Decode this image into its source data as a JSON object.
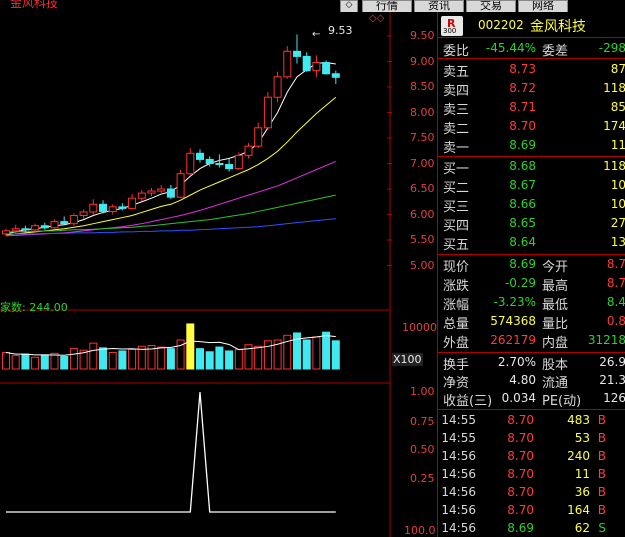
{
  "window": {
    "title": "金风科技",
    "menus": [
      "行情",
      "资讯",
      "交易",
      "网络"
    ]
  },
  "stock": {
    "code": "002202",
    "name": "金风科技",
    "badge": "R",
    "badge_sub": "300"
  },
  "chart": {
    "max_price_label": "9.53",
    "price_ticks": [
      "9.50",
      "9.00",
      "8.50",
      "8.00",
      "7.50",
      "7.00",
      "6.50",
      "6.00",
      "5.50",
      "5.00"
    ],
    "volume_ticks": [
      "10000",
      "X100"
    ],
    "volume_label": "家数: 244.00",
    "indicator_ticks": [
      "1.00",
      "0.75",
      "0.50",
      "0.25",
      "100.0"
    ],
    "colors": {
      "up": "#ff3030",
      "down": "#40e8f0",
      "ma5": "#ffffff",
      "ma10": "#ffff40",
      "ma20": "#e030e0",
      "ma30": "#30c030",
      "ma60": "#3030ff"
    },
    "candles": [
      {
        "o": 5.62,
        "h": 5.72,
        "l": 5.58,
        "c": 5.68
      },
      {
        "o": 5.68,
        "h": 5.8,
        "l": 5.62,
        "c": 5.72
      },
      {
        "o": 5.72,
        "h": 5.78,
        "l": 5.64,
        "c": 5.7
      },
      {
        "o": 5.7,
        "h": 5.82,
        "l": 5.66,
        "c": 5.78
      },
      {
        "o": 5.78,
        "h": 5.84,
        "l": 5.7,
        "c": 5.74
      },
      {
        "o": 5.74,
        "h": 5.9,
        "l": 5.72,
        "c": 5.86
      },
      {
        "o": 5.86,
        "h": 5.96,
        "l": 5.8,
        "c": 5.82
      },
      {
        "o": 5.82,
        "h": 6.02,
        "l": 5.78,
        "c": 5.98
      },
      {
        "o": 5.98,
        "h": 6.1,
        "l": 5.92,
        "c": 6.05
      },
      {
        "o": 6.05,
        "h": 6.3,
        "l": 6.0,
        "c": 6.2
      },
      {
        "o": 6.2,
        "h": 6.28,
        "l": 6.02,
        "c": 6.06
      },
      {
        "o": 6.06,
        "h": 6.2,
        "l": 6.0,
        "c": 6.15
      },
      {
        "o": 6.15,
        "h": 6.22,
        "l": 6.08,
        "c": 6.12
      },
      {
        "o": 6.12,
        "h": 6.4,
        "l": 6.1,
        "c": 6.32
      },
      {
        "o": 6.32,
        "h": 6.48,
        "l": 6.26,
        "c": 6.42
      },
      {
        "o": 6.42,
        "h": 6.52,
        "l": 6.36,
        "c": 6.46
      },
      {
        "o": 6.46,
        "h": 6.58,
        "l": 6.4,
        "c": 6.5
      },
      {
        "o": 6.5,
        "h": 6.58,
        "l": 6.3,
        "c": 6.34
      },
      {
        "o": 6.34,
        "h": 6.88,
        "l": 6.32,
        "c": 6.8
      },
      {
        "o": 6.8,
        "h": 7.3,
        "l": 6.76,
        "c": 7.2
      },
      {
        "o": 7.2,
        "h": 7.28,
        "l": 7.02,
        "c": 7.08
      },
      {
        "o": 7.08,
        "h": 7.14,
        "l": 6.94,
        "c": 7.0
      },
      {
        "o": 7.0,
        "h": 7.18,
        "l": 6.92,
        "c": 6.98
      },
      {
        "o": 6.98,
        "h": 7.1,
        "l": 6.84,
        "c": 6.9
      },
      {
        "o": 6.9,
        "h": 7.22,
        "l": 6.88,
        "c": 7.16
      },
      {
        "o": 7.16,
        "h": 7.4,
        "l": 7.1,
        "c": 7.34
      },
      {
        "o": 7.34,
        "h": 7.8,
        "l": 7.3,
        "c": 7.7
      },
      {
        "o": 7.7,
        "h": 8.4,
        "l": 7.66,
        "c": 8.3
      },
      {
        "o": 8.3,
        "h": 8.8,
        "l": 8.2,
        "c": 8.7
      },
      {
        "o": 8.7,
        "h": 9.3,
        "l": 8.66,
        "c": 9.2
      },
      {
        "o": 9.2,
        "h": 9.53,
        "l": 8.96,
        "c": 9.1
      },
      {
        "o": 9.1,
        "h": 9.18,
        "l": 8.8,
        "c": 8.82
      },
      {
        "o": 8.82,
        "h": 9.12,
        "l": 8.7,
        "c": 8.98
      },
      {
        "o": 8.98,
        "h": 9.02,
        "l": 8.74,
        "c": 8.76
      },
      {
        "o": 8.76,
        "h": 8.82,
        "l": 8.56,
        "c": 8.69
      }
    ],
    "ma_lines": [
      {
        "name": "ma5",
        "color": "#ffffff",
        "pts": [
          5.62,
          5.66,
          5.7,
          5.72,
          5.75,
          5.78,
          5.8,
          5.84,
          5.9,
          5.98,
          6.04,
          6.08,
          6.12,
          6.18,
          6.25,
          6.32,
          6.4,
          6.45,
          6.58,
          6.75,
          6.9,
          7.0,
          7.06,
          7.1,
          7.16,
          7.24,
          7.4,
          7.7,
          8.0,
          8.4,
          8.7,
          8.84,
          8.96,
          8.98,
          8.95
        ]
      },
      {
        "name": "ma10",
        "color": "#ffff40",
        "pts": [
          5.6,
          5.62,
          5.64,
          5.66,
          5.68,
          5.7,
          5.72,
          5.75,
          5.78,
          5.82,
          5.86,
          5.9,
          5.94,
          5.98,
          6.04,
          6.1,
          6.16,
          6.2,
          6.28,
          6.38,
          6.48,
          6.56,
          6.64,
          6.72,
          6.8,
          6.88,
          6.98,
          7.1,
          7.24,
          7.42,
          7.62,
          7.8,
          7.98,
          8.14,
          8.3
        ]
      },
      {
        "name": "ma20",
        "color": "#e030e0",
        "pts": [
          5.58,
          5.59,
          5.6,
          5.61,
          5.62,
          5.63,
          5.64,
          5.66,
          5.68,
          5.7,
          5.72,
          5.74,
          5.76,
          5.79,
          5.82,
          5.86,
          5.9,
          5.94,
          5.98,
          6.03,
          6.08,
          6.14,
          6.2,
          6.26,
          6.32,
          6.38,
          6.44,
          6.5,
          6.56,
          6.64,
          6.72,
          6.8,
          6.88,
          6.96,
          7.04
        ]
      },
      {
        "name": "ma30",
        "color": "#30c030",
        "pts": [
          5.66,
          5.66,
          5.67,
          5.67,
          5.68,
          5.68,
          5.69,
          5.7,
          5.7,
          5.71,
          5.72,
          5.73,
          5.74,
          5.75,
          5.77,
          5.78,
          5.8,
          5.82,
          5.84,
          5.86,
          5.88,
          5.9,
          5.93,
          5.96,
          5.99,
          6.02,
          6.06,
          6.1,
          6.14,
          6.18,
          6.22,
          6.26,
          6.3,
          6.34,
          6.38
        ]
      },
      {
        "name": "ma60",
        "color": "#3050ff",
        "pts": [
          5.62,
          5.62,
          5.62,
          5.62,
          5.63,
          5.63,
          5.63,
          5.64,
          5.64,
          5.64,
          5.65,
          5.65,
          5.66,
          5.66,
          5.67,
          5.67,
          5.68,
          5.68,
          5.69,
          5.69,
          5.7,
          5.71,
          5.72,
          5.73,
          5.74,
          5.75,
          5.76,
          5.78,
          5.8,
          5.82,
          5.84,
          5.86,
          5.88,
          5.9,
          5.92
        ]
      }
    ],
    "volumes": [
      4200,
      3400,
      3800,
      3000,
      3600,
      4000,
      3200,
      5200,
      4800,
      6600,
      5400,
      4200,
      4600,
      5000,
      5800,
      6000,
      5600,
      5200,
      7400,
      11500,
      5200,
      4400,
      5600,
      4600,
      5000,
      6200,
      5800,
      7200,
      7400,
      8600,
      9200,
      7400,
      8200,
      9400,
      7200
    ],
    "indicator": [
      0,
      0,
      0,
      0,
      0,
      0,
      0,
      0,
      0,
      0,
      0,
      0,
      0,
      0,
      0,
      0,
      0,
      0,
      0,
      0,
      1.0,
      0,
      0,
      0,
      0,
      0,
      0,
      0,
      0,
      0,
      0,
      0,
      0,
      0,
      0
    ]
  },
  "quote": {
    "weibi_label": "委比",
    "weibi": "-45.44%",
    "weicha_label": "委差",
    "weicha": "-298",
    "asks": [
      {
        "label": "卖五",
        "price": "8.73",
        "vol": "87"
      },
      {
        "label": "卖四",
        "price": "8.72",
        "vol": "118"
      },
      {
        "label": "卖三",
        "price": "8.71",
        "vol": "85"
      },
      {
        "label": "卖二",
        "price": "8.70",
        "vol": "174"
      },
      {
        "label": "卖一",
        "price": "8.69",
        "vol": "11"
      }
    ],
    "bids": [
      {
        "label": "买一",
        "price": "8.68",
        "vol": "118"
      },
      {
        "label": "买二",
        "price": "8.67",
        "vol": "10"
      },
      {
        "label": "买三",
        "price": "8.66",
        "vol": "10"
      },
      {
        "label": "买四",
        "price": "8.65",
        "vol": "27"
      },
      {
        "label": "买五",
        "price": "8.64",
        "vol": "13"
      }
    ],
    "stats": [
      {
        "l1": "现价",
        "v1": "8.69",
        "c1": "green",
        "l2": "今开",
        "v2": "8.7",
        "c2": "red"
      },
      {
        "l1": "涨跌",
        "v1": "-0.29",
        "c1": "green",
        "l2": "最高",
        "v2": "8.7",
        "c2": "red"
      },
      {
        "l1": "涨幅",
        "v1": "-3.23%",
        "c1": "green",
        "l2": "最低",
        "v2": "8.4",
        "c2": "green"
      },
      {
        "l1": "总量",
        "v1": "574368",
        "c1": "yel",
        "l2": "量比",
        "v2": "0.8",
        "c2": "red"
      },
      {
        "l1": "外盘",
        "v1": "262179",
        "c1": "red",
        "l2": "内盘",
        "v2": "31218",
        "c2": "green"
      }
    ],
    "stats2": [
      {
        "l1": "换手",
        "v1": "2.70%",
        "l2": "股本",
        "v2": "26.9"
      },
      {
        "l1": "净资",
        "v1": "4.80",
        "l2": "流通",
        "v2": "21.3"
      },
      {
        "l1": "收益(三)",
        "v1": "0.034",
        "l2": "PE(动)",
        "v2": "126"
      }
    ],
    "ticks": [
      {
        "time": "14:55",
        "price": "8.70",
        "vol": "483",
        "side": "B"
      },
      {
        "time": "14:55",
        "price": "8.70",
        "vol": "53",
        "side": "B"
      },
      {
        "time": "14:56",
        "price": "8.70",
        "vol": "240",
        "side": "B"
      },
      {
        "time": "14:56",
        "price": "8.70",
        "vol": "11",
        "side": "B"
      },
      {
        "time": "14:56",
        "price": "8.70",
        "vol": "36",
        "side": "B"
      },
      {
        "time": "14:56",
        "price": "8.70",
        "vol": "164",
        "side": "B"
      },
      {
        "time": "14:56",
        "price": "8.69",
        "vol": "62",
        "side": "S"
      }
    ]
  }
}
